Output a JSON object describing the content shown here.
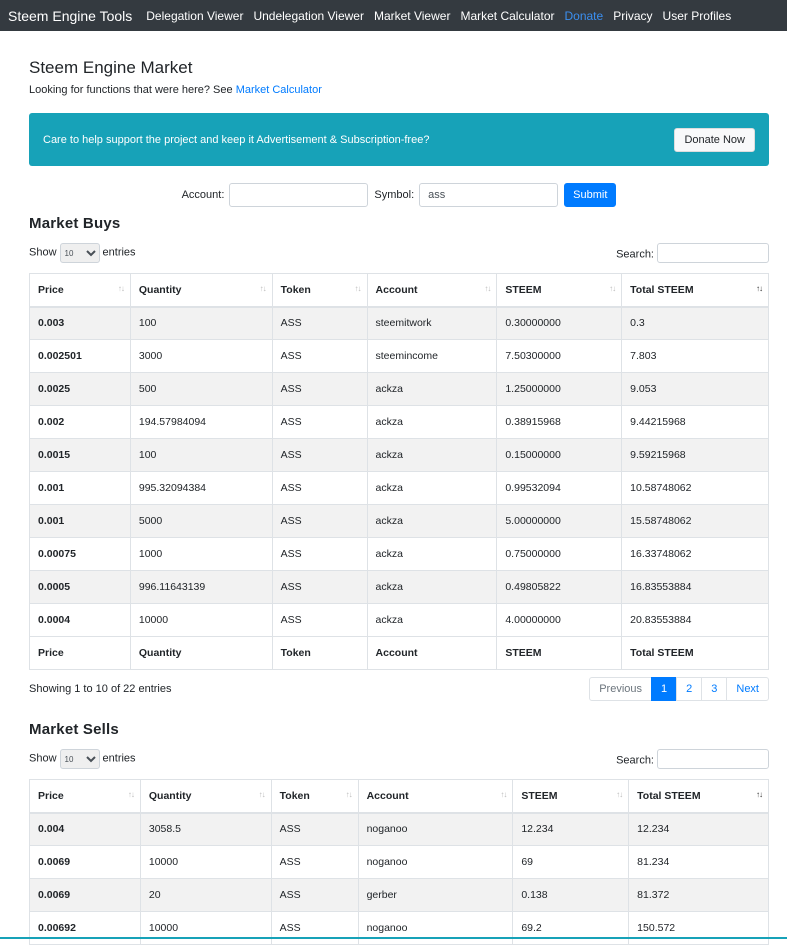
{
  "nav": {
    "brand": "Steem Engine Tools",
    "links": [
      "Delegation Viewer",
      "Undelegation Viewer",
      "Market Viewer",
      "Market Calculator",
      "Donate",
      "Privacy",
      "User Profiles"
    ]
  },
  "page": {
    "title": "Steem Engine Market",
    "subtitle_prefix": "Looking for functions that were here? See ",
    "subtitle_link": "Market Calculator"
  },
  "banner": {
    "text": "Care to help support the project and keep it Advertisement & Subscription-free?",
    "button": "Donate Now"
  },
  "form": {
    "account_label": "Account:",
    "account_value": "",
    "symbol_label": "Symbol:",
    "symbol_value": "ass",
    "submit": "Submit"
  },
  "columns": [
    "Price",
    "Quantity",
    "Token",
    "Account",
    "STEEM",
    "Total STEEM"
  ],
  "controls": {
    "show": "Show",
    "entries": "entries",
    "length_value": "10",
    "search_label": "Search:"
  },
  "buys": {
    "title": "Market Buys",
    "info": "Showing 1 to 10 of 22 entries",
    "pagination": [
      "Previous",
      "1",
      "2",
      "3",
      "Next"
    ],
    "rows": [
      [
        "0.003",
        "100",
        "ASS",
        "steemitwork",
        "0.30000000",
        "0.3"
      ],
      [
        "0.002501",
        "3000",
        "ASS",
        "steemincome",
        "7.50300000",
        "7.803"
      ],
      [
        "0.0025",
        "500",
        "ASS",
        "ackza",
        "1.25000000",
        "9.053"
      ],
      [
        "0.002",
        "194.57984094",
        "ASS",
        "ackza",
        "0.38915968",
        "9.44215968"
      ],
      [
        "0.0015",
        "100",
        "ASS",
        "ackza",
        "0.15000000",
        "9.59215968"
      ],
      [
        "0.001",
        "995.32094384",
        "ASS",
        "ackza",
        "0.99532094",
        "10.58748062"
      ],
      [
        "0.001",
        "5000",
        "ASS",
        "ackza",
        "5.00000000",
        "15.58748062"
      ],
      [
        "0.00075",
        "1000",
        "ASS",
        "ackza",
        "0.75000000",
        "16.33748062"
      ],
      [
        "0.0005",
        "996.11643139",
        "ASS",
        "ackza",
        "0.49805822",
        "16.83553884"
      ],
      [
        "0.0004",
        "10000",
        "ASS",
        "ackza",
        "4.00000000",
        "20.83553884"
      ]
    ]
  },
  "sells": {
    "title": "Market Sells",
    "rows": [
      [
        "0.004",
        "3058.5",
        "ASS",
        "noganoo",
        "12.234",
        "12.234"
      ],
      [
        "0.0069",
        "10000",
        "ASS",
        "noganoo",
        "69",
        "81.234"
      ],
      [
        "0.0069",
        "20",
        "ASS",
        "gerber",
        "0.138",
        "81.372"
      ],
      [
        "0.00692",
        "10000",
        "ASS",
        "noganoo",
        "69.2",
        "150.572"
      ]
    ]
  }
}
